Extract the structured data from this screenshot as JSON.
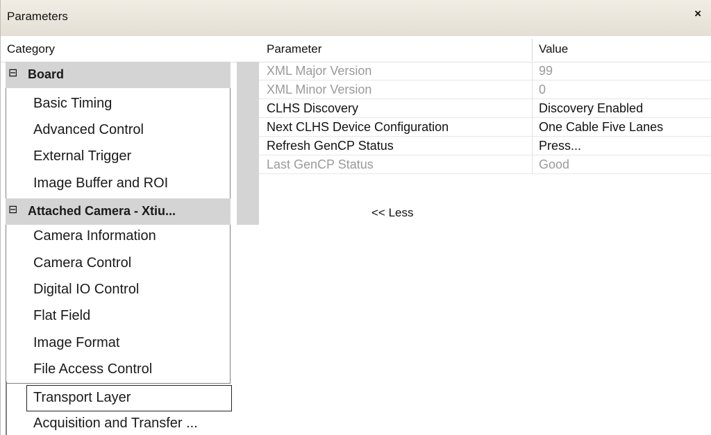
{
  "window": {
    "title": "Parameters",
    "close_glyph": "×"
  },
  "columns": {
    "category": "Category",
    "parameter": "Parameter",
    "value": "Value"
  },
  "categories": [
    {
      "type": "group",
      "label": "Board",
      "toggle": "⊟"
    },
    {
      "type": "item",
      "label": "Basic Timing"
    },
    {
      "type": "item",
      "label": "Advanced Control"
    },
    {
      "type": "item",
      "label": "External Trigger"
    },
    {
      "type": "item",
      "label": "Image Buffer and ROI"
    },
    {
      "type": "group",
      "label": "Attached Camera - Xtiu...",
      "toggle": "⊟"
    },
    {
      "type": "item",
      "label": "Camera Information"
    },
    {
      "type": "item",
      "label": "Camera Control"
    },
    {
      "type": "item",
      "label": "Digital IO Control"
    },
    {
      "type": "item",
      "label": "Flat Field"
    },
    {
      "type": "item",
      "label": "Image Format"
    },
    {
      "type": "item",
      "label": "File Access Control"
    },
    {
      "type": "item",
      "label": "Transport Layer",
      "selected": true
    },
    {
      "type": "item",
      "label": "Acquisition and Transfer ..."
    }
  ],
  "parameters": [
    {
      "name": "XML Major Version",
      "value": "99",
      "enabled": false
    },
    {
      "name": "XML Minor Version",
      "value": "0",
      "enabled": false
    },
    {
      "name": "CLHS Discovery",
      "value": "Discovery Enabled",
      "enabled": true
    },
    {
      "name": "Next CLHS Device Configuration",
      "value": "One Cable Five Lanes",
      "enabled": true
    },
    {
      "name": "Refresh GenCP Status",
      "value": "Press...",
      "enabled": true
    },
    {
      "name": "Last GenCP Status",
      "value": "Good",
      "enabled": false
    }
  ],
  "less_link": "<< Less",
  "colors": {
    "group_background": "#d4d4d4",
    "disabled_text": "#9a9a9a",
    "titlebar": "#e9e5dc"
  }
}
